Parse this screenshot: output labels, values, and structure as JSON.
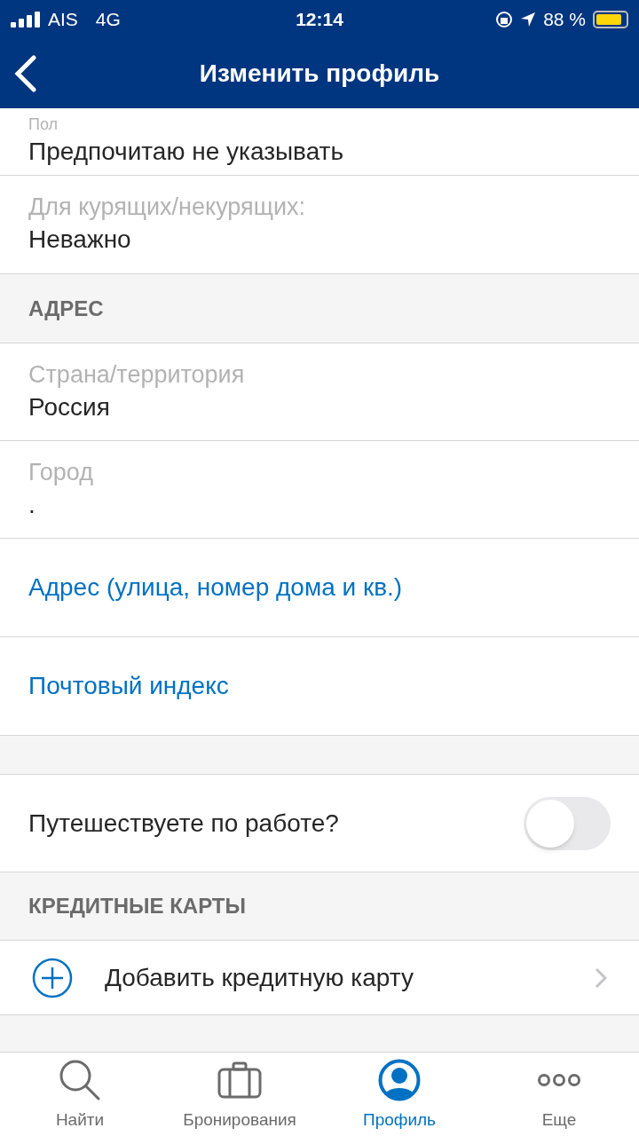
{
  "status_bar": {
    "carrier": "AIS",
    "network": "4G",
    "time": "12:14",
    "battery": "88 %"
  },
  "nav": {
    "title": "Изменить профиль"
  },
  "personal_fields": [
    {
      "label": "Пол",
      "value": "Предпочитаю не указывать"
    },
    {
      "label": "Для курящих/некурящих:",
      "value": "Неважно"
    }
  ],
  "address": {
    "header": "АДРЕС",
    "fields": [
      {
        "label": "Страна/территория",
        "value": "Россия"
      },
      {
        "label": "Город",
        "value": "."
      }
    ],
    "links": [
      "Адрес (улица, номер дома и кв.)",
      "Почтовый индекс"
    ]
  },
  "business_travel": {
    "label": "Путешествуете по работе?",
    "on": false
  },
  "credit_cards": {
    "header": "КРЕДИТНЫЕ КАРТЫ",
    "add_label": "Добавить кредитную карту"
  },
  "tabs": [
    {
      "label": "Найти",
      "kind": "search",
      "selected": false
    },
    {
      "label": "Бронирования",
      "kind": "bookings",
      "selected": false
    },
    {
      "label": "Профиль",
      "kind": "profile",
      "selected": true
    },
    {
      "label": "Еще",
      "kind": "more",
      "selected": false
    }
  ]
}
